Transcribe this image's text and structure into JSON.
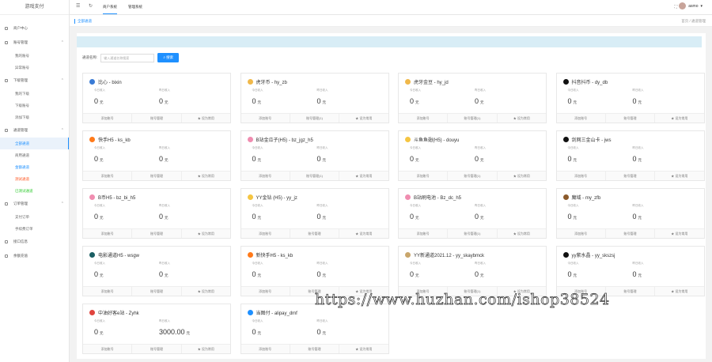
{
  "app_title": "游戏支付",
  "sidebar": {
    "home": "商户中心",
    "groups": [
      {
        "label": "账号管理",
        "items": [
          "我的账号",
          "异常账号"
        ]
      },
      {
        "label": "下级管理",
        "items": [
          "我的下级",
          "下级账号",
          "添加下级"
        ]
      },
      {
        "label": "通道管理",
        "items": [
          "全部通道",
          "商用通道",
          "金额通道",
          "测试通道",
          "已测试通道"
        ]
      },
      {
        "label": "订单管理",
        "items": [
          "支付订单",
          "手续费订单"
        ]
      }
    ],
    "extra": [
      "接口信息",
      "余额充值"
    ],
    "item_colors": {
      "金额通道": "#1e90ff",
      "测试通道": "#ff5722",
      "已测试通道": "#33cc33"
    }
  },
  "topbar": {
    "tabs": [
      "商户系统",
      "管理系统"
    ],
    "username": "asmo"
  },
  "breadcrumb": {
    "left": "全部通道",
    "right": "首页 / 通道管理"
  },
  "search": {
    "label": "通道名称:",
    "placeholder": "输入通道名称搜索",
    "button": "搜索"
  },
  "card_labels": {
    "today": "今日收入",
    "yesterday": "昨日收入",
    "unit": "元",
    "add": "添加账号",
    "manage": "账号管理",
    "common": "设为常用"
  },
  "channels": [
    {
      "title": "比心 - bixin",
      "icon": "#3a7bd5",
      "today": "0",
      "yesterday": "0",
      "count": ""
    },
    {
      "title": "虎牙币 - hy_zb",
      "icon": "#f0b84a",
      "today": "0",
      "yesterday": "0",
      "count": "(1)"
    },
    {
      "title": "虎牙金豆 - hy_jd",
      "icon": "#f0b84a",
      "today": "0",
      "yesterday": "0",
      "count": "(1)"
    },
    {
      "title": "抖音抖币 - dy_db",
      "icon": "#111111",
      "today": "0",
      "yesterday": "0",
      "count": ""
    },
    {
      "title": "快手H5 - ks_kb",
      "icon": "#ff7a1a",
      "today": "0",
      "yesterday": "0",
      "count": ""
    },
    {
      "title": "B站金瓜子(H5) - bz_jgz_h5",
      "icon": "#f08db0",
      "today": "0",
      "yesterday": "0",
      "count": "(1)"
    },
    {
      "title": "斗鱼鱼翅(H5) - douyu",
      "icon": "#f5c542",
      "today": "0",
      "yesterday": "0",
      "count": "(1)"
    },
    {
      "title": "剑网三金山卡 - jws",
      "icon": "#111111",
      "today": "0",
      "yesterday": "0",
      "count": ""
    },
    {
      "title": "B币H5 - bz_bi_h5",
      "icon": "#f08db0",
      "today": "0",
      "yesterday": "0",
      "count": ""
    },
    {
      "title": "YY金钻 (H5) - yy_jz",
      "icon": "#f5c542",
      "today": "0",
      "yesterday": "0",
      "count": ""
    },
    {
      "title": "B站刷电池 - Bz_dc_h5",
      "icon": "#f08db0",
      "today": "0",
      "yesterday": "0",
      "count": "(1)"
    },
    {
      "title": "魔域 - my_zfb",
      "icon": "#8b5a2b",
      "today": "0",
      "yesterday": "0",
      "count": ""
    },
    {
      "title": "电影通道H5 - wsgw",
      "icon": "#1a5e63",
      "today": "0",
      "yesterday": "0",
      "count": ""
    },
    {
      "title": "新快手H5 - ks_kb",
      "icon": "#ff7a1a",
      "today": "0",
      "yesterday": "0",
      "count": ""
    },
    {
      "title": "YY新通道2021.12 - yy_skaybmck",
      "icon": "#c9a66b",
      "today": "0",
      "yesterday": "0",
      "count": "(1)"
    },
    {
      "title": "yy紫水晶 - yy_skszsj",
      "icon": "#111111",
      "today": "0",
      "yesterday": "0",
      "count": ""
    },
    {
      "title": "中油好客e站 - Zyhk",
      "icon": "#e0443e",
      "today": "0",
      "yesterday": "3000.00",
      "count": ""
    },
    {
      "title": "当图付 - alipay_dmf",
      "icon": "#1e90ff",
      "today": "0",
      "yesterday": "0",
      "count": ""
    }
  ],
  "watermark": "https://www.huzhan.com/ishop38524"
}
